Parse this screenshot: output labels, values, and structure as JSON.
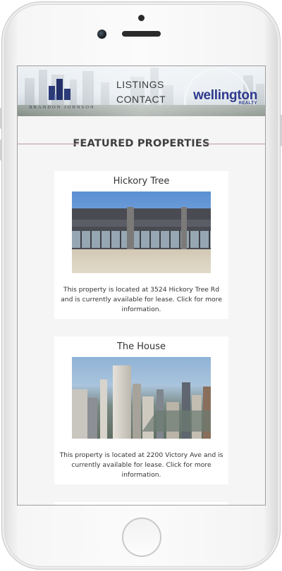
{
  "header": {
    "brand_left": "BRANDON JOHNSON",
    "nav": [
      {
        "label": "LISTINGS"
      },
      {
        "label": "CONTACT"
      }
    ],
    "brand_right": {
      "name": "wellington",
      "sub": "REALTY"
    }
  },
  "section": {
    "title": "FEATURED PROPERTIES"
  },
  "properties": [
    {
      "title": "Hickory Tree",
      "description": "This property is located at 3524 Hickory Tree Rd and is currently available for lease. Click for more information."
    },
    {
      "title": "The House",
      "description": "This property is located at 2200 Victory Ave and is currently available for lease. Click for more information."
    }
  ],
  "colors": {
    "brand_blue": "#2d3a8c",
    "divider": "#b89a9a",
    "screen_bg": "#f5f5f5"
  }
}
